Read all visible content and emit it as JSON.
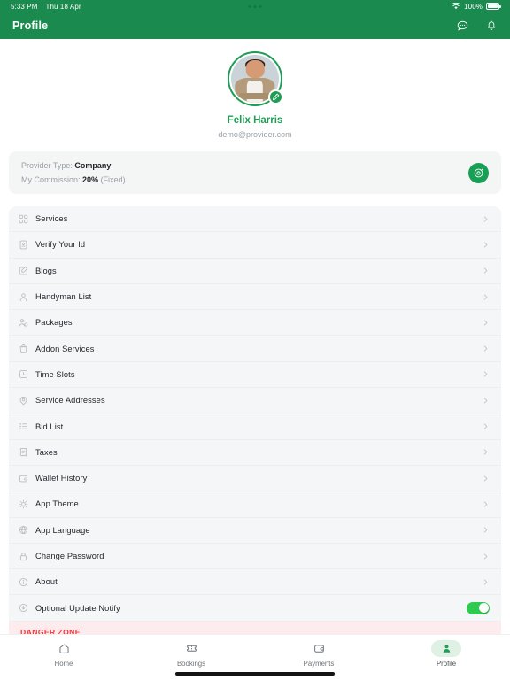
{
  "status_bar": {
    "time": "5:33 PM",
    "date": "Thu 18 Apr",
    "battery_percent": "100%",
    "wifi_icon": "wifi-icon",
    "battery_icon": "battery-full-icon",
    "dots_icon": "camera-dots-icon"
  },
  "app_bar": {
    "title": "Profile",
    "chat_icon": "chat-bubble-icon",
    "notification_icon": "bell-icon",
    "background_color": "#1a8a4f"
  },
  "profile": {
    "name": "Felix Harris",
    "email": "demo@provider.com",
    "avatar_icon": "user-avatar",
    "edit_icon": "pencil-edit-icon",
    "name_color": "#1f9d55"
  },
  "info_card": {
    "provider_type_label": "Provider Type:",
    "provider_type_value": "Company",
    "commission_label": "My Commission:",
    "commission_value": "20%",
    "commission_suffix": "(Fixed)",
    "badge_icon": "target-circle-icon",
    "badge_color": "#17a055"
  },
  "menu": {
    "items": [
      {
        "label": "Services",
        "icon": "grid-apps-icon",
        "trailing": "chevron"
      },
      {
        "label": "Verify Your Id",
        "icon": "id-card-icon",
        "trailing": "chevron"
      },
      {
        "label": "Blogs",
        "icon": "edit-square-icon",
        "trailing": "chevron"
      },
      {
        "label": "Handyman List",
        "icon": "user-person-icon",
        "trailing": "chevron"
      },
      {
        "label": "Packages",
        "icon": "users-group-icon",
        "trailing": "chevron"
      },
      {
        "label": "Addon Services",
        "icon": "shopping-bag-icon",
        "trailing": "chevron"
      },
      {
        "label": "Time Slots",
        "icon": "clock-icon",
        "trailing": "chevron"
      },
      {
        "label": "Service Addresses",
        "icon": "map-pin-icon",
        "trailing": "chevron"
      },
      {
        "label": "Bid List",
        "icon": "list-bullet-icon",
        "trailing": "chevron"
      },
      {
        "label": "Taxes",
        "icon": "receipt-tax-icon",
        "trailing": "chevron"
      },
      {
        "label": "Wallet History",
        "icon": "wallet-icon",
        "trailing": "chevron"
      },
      {
        "label": "App Theme",
        "icon": "theme-sun-icon",
        "trailing": "chevron"
      },
      {
        "label": "App Language",
        "icon": "globe-icon",
        "trailing": "chevron"
      },
      {
        "label": "Change Password",
        "icon": "lock-icon",
        "trailing": "chevron"
      },
      {
        "label": "About",
        "icon": "info-circle-icon",
        "trailing": "chevron"
      },
      {
        "label": "Optional Update Notify",
        "icon": "update-download-icon",
        "trailing": "toggle",
        "toggle_on": true
      }
    ]
  },
  "danger_zone": {
    "label": "DANGER ZONE",
    "text_color": "#f2353c",
    "background_color": "#fdeced"
  },
  "bottom_nav": {
    "items": [
      {
        "label": "Home",
        "icon": "home-icon",
        "active": false
      },
      {
        "label": "Bookings",
        "icon": "ticket-icon",
        "active": false
      },
      {
        "label": "Payments",
        "icon": "wallet-icon",
        "active": false
      },
      {
        "label": "Profile",
        "icon": "person-icon",
        "active": true
      }
    ],
    "active_color": "#1f9d55"
  }
}
